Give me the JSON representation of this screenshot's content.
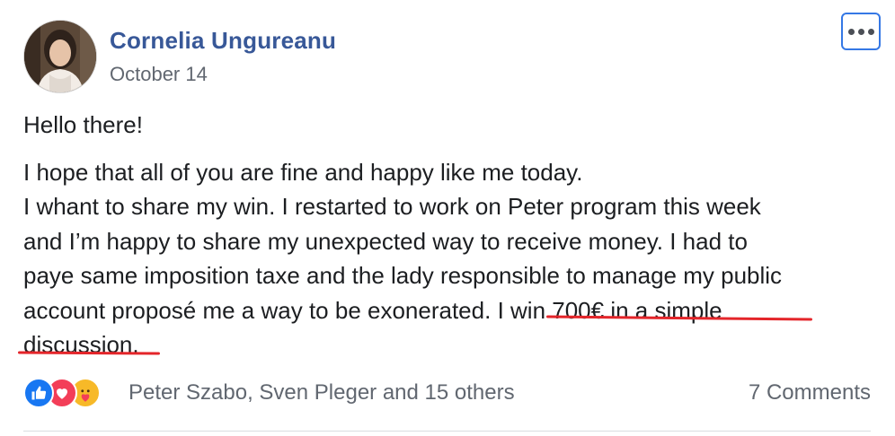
{
  "post": {
    "author": "Cornelia Ungureanu",
    "date": "October 14",
    "greeting": "Hello there!",
    "lines": [
      "I hope that all of you are fine and happy like me today.",
      "I whant to share my win. I restarted to work on Peter program this week",
      "and I’m happy to share my unexpected way to receive money. I had to",
      "paye same imposition taxe and the lady responsible to manage my public"
    ],
    "line5_plain": "account proposé me a way to be exonerated.",
    "line5_highlight": " I win 700€ in a simple",
    "line6_highlight": "discussion."
  },
  "menu": {
    "icon": "more-options-icon"
  },
  "reactions": {
    "icons": [
      "like-icon",
      "love-icon",
      "care-icon"
    ],
    "reactors": "Peter Szabo, Sven Pleger and 15 others",
    "comments": "7 Comments"
  },
  "colors": {
    "author": "#385898",
    "secondary_text": "#616770",
    "body_text": "#1c1e21",
    "highlight_underline": "#e4252a",
    "menu_border": "#3578e5",
    "like": "#1877f2",
    "love": "#f33e58",
    "care": "#f7b928"
  }
}
